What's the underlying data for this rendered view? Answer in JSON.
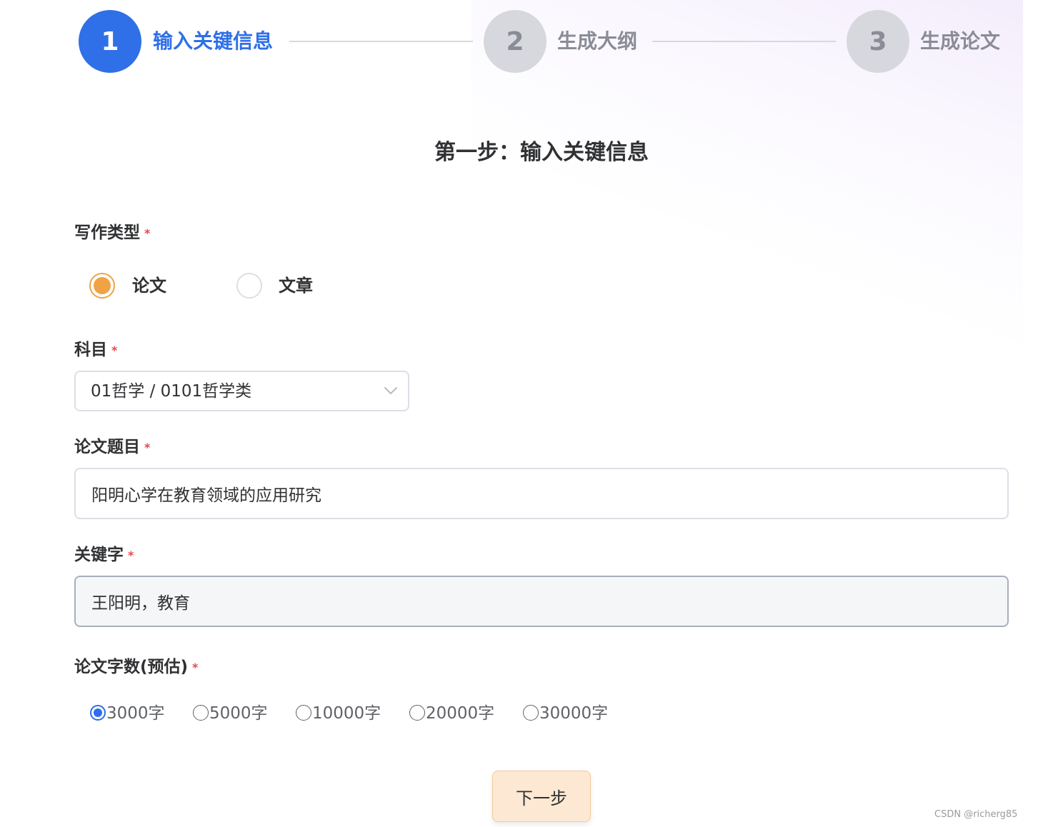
{
  "steps": [
    {
      "number": "1",
      "label": "输入关键信息"
    },
    {
      "number": "2",
      "label": "生成大纲"
    },
    {
      "number": "3",
      "label": "生成论文"
    }
  ],
  "page_title": "第一步：输入关键信息",
  "required_mark": "*",
  "writing_type": {
    "label": "写作类型",
    "options": [
      {
        "label": "论文",
        "checked": true
      },
      {
        "label": "文章",
        "checked": false
      }
    ]
  },
  "subject": {
    "label": "科目",
    "value": "01哲学 / 0101哲学类"
  },
  "title_field": {
    "label": "论文题目",
    "value": "阳明心学在教育领域的应用研究"
  },
  "keywords_field": {
    "label": "关键字",
    "value": "王阳明，教育"
  },
  "word_count": {
    "label": "论文字数(预估)",
    "options": [
      {
        "label": "3000字",
        "checked": true
      },
      {
        "label": "5000字",
        "checked": false
      },
      {
        "label": "10000字",
        "checked": false
      },
      {
        "label": "20000字",
        "checked": false
      },
      {
        "label": "30000字",
        "checked": false
      }
    ]
  },
  "next_button": "下一步",
  "watermark": "CSDN @richerg85",
  "colors": {
    "primary": "#2f6fe8",
    "accent_orange": "#f0a245",
    "required": "#e5484d",
    "button_bg": "#fde9d3"
  }
}
